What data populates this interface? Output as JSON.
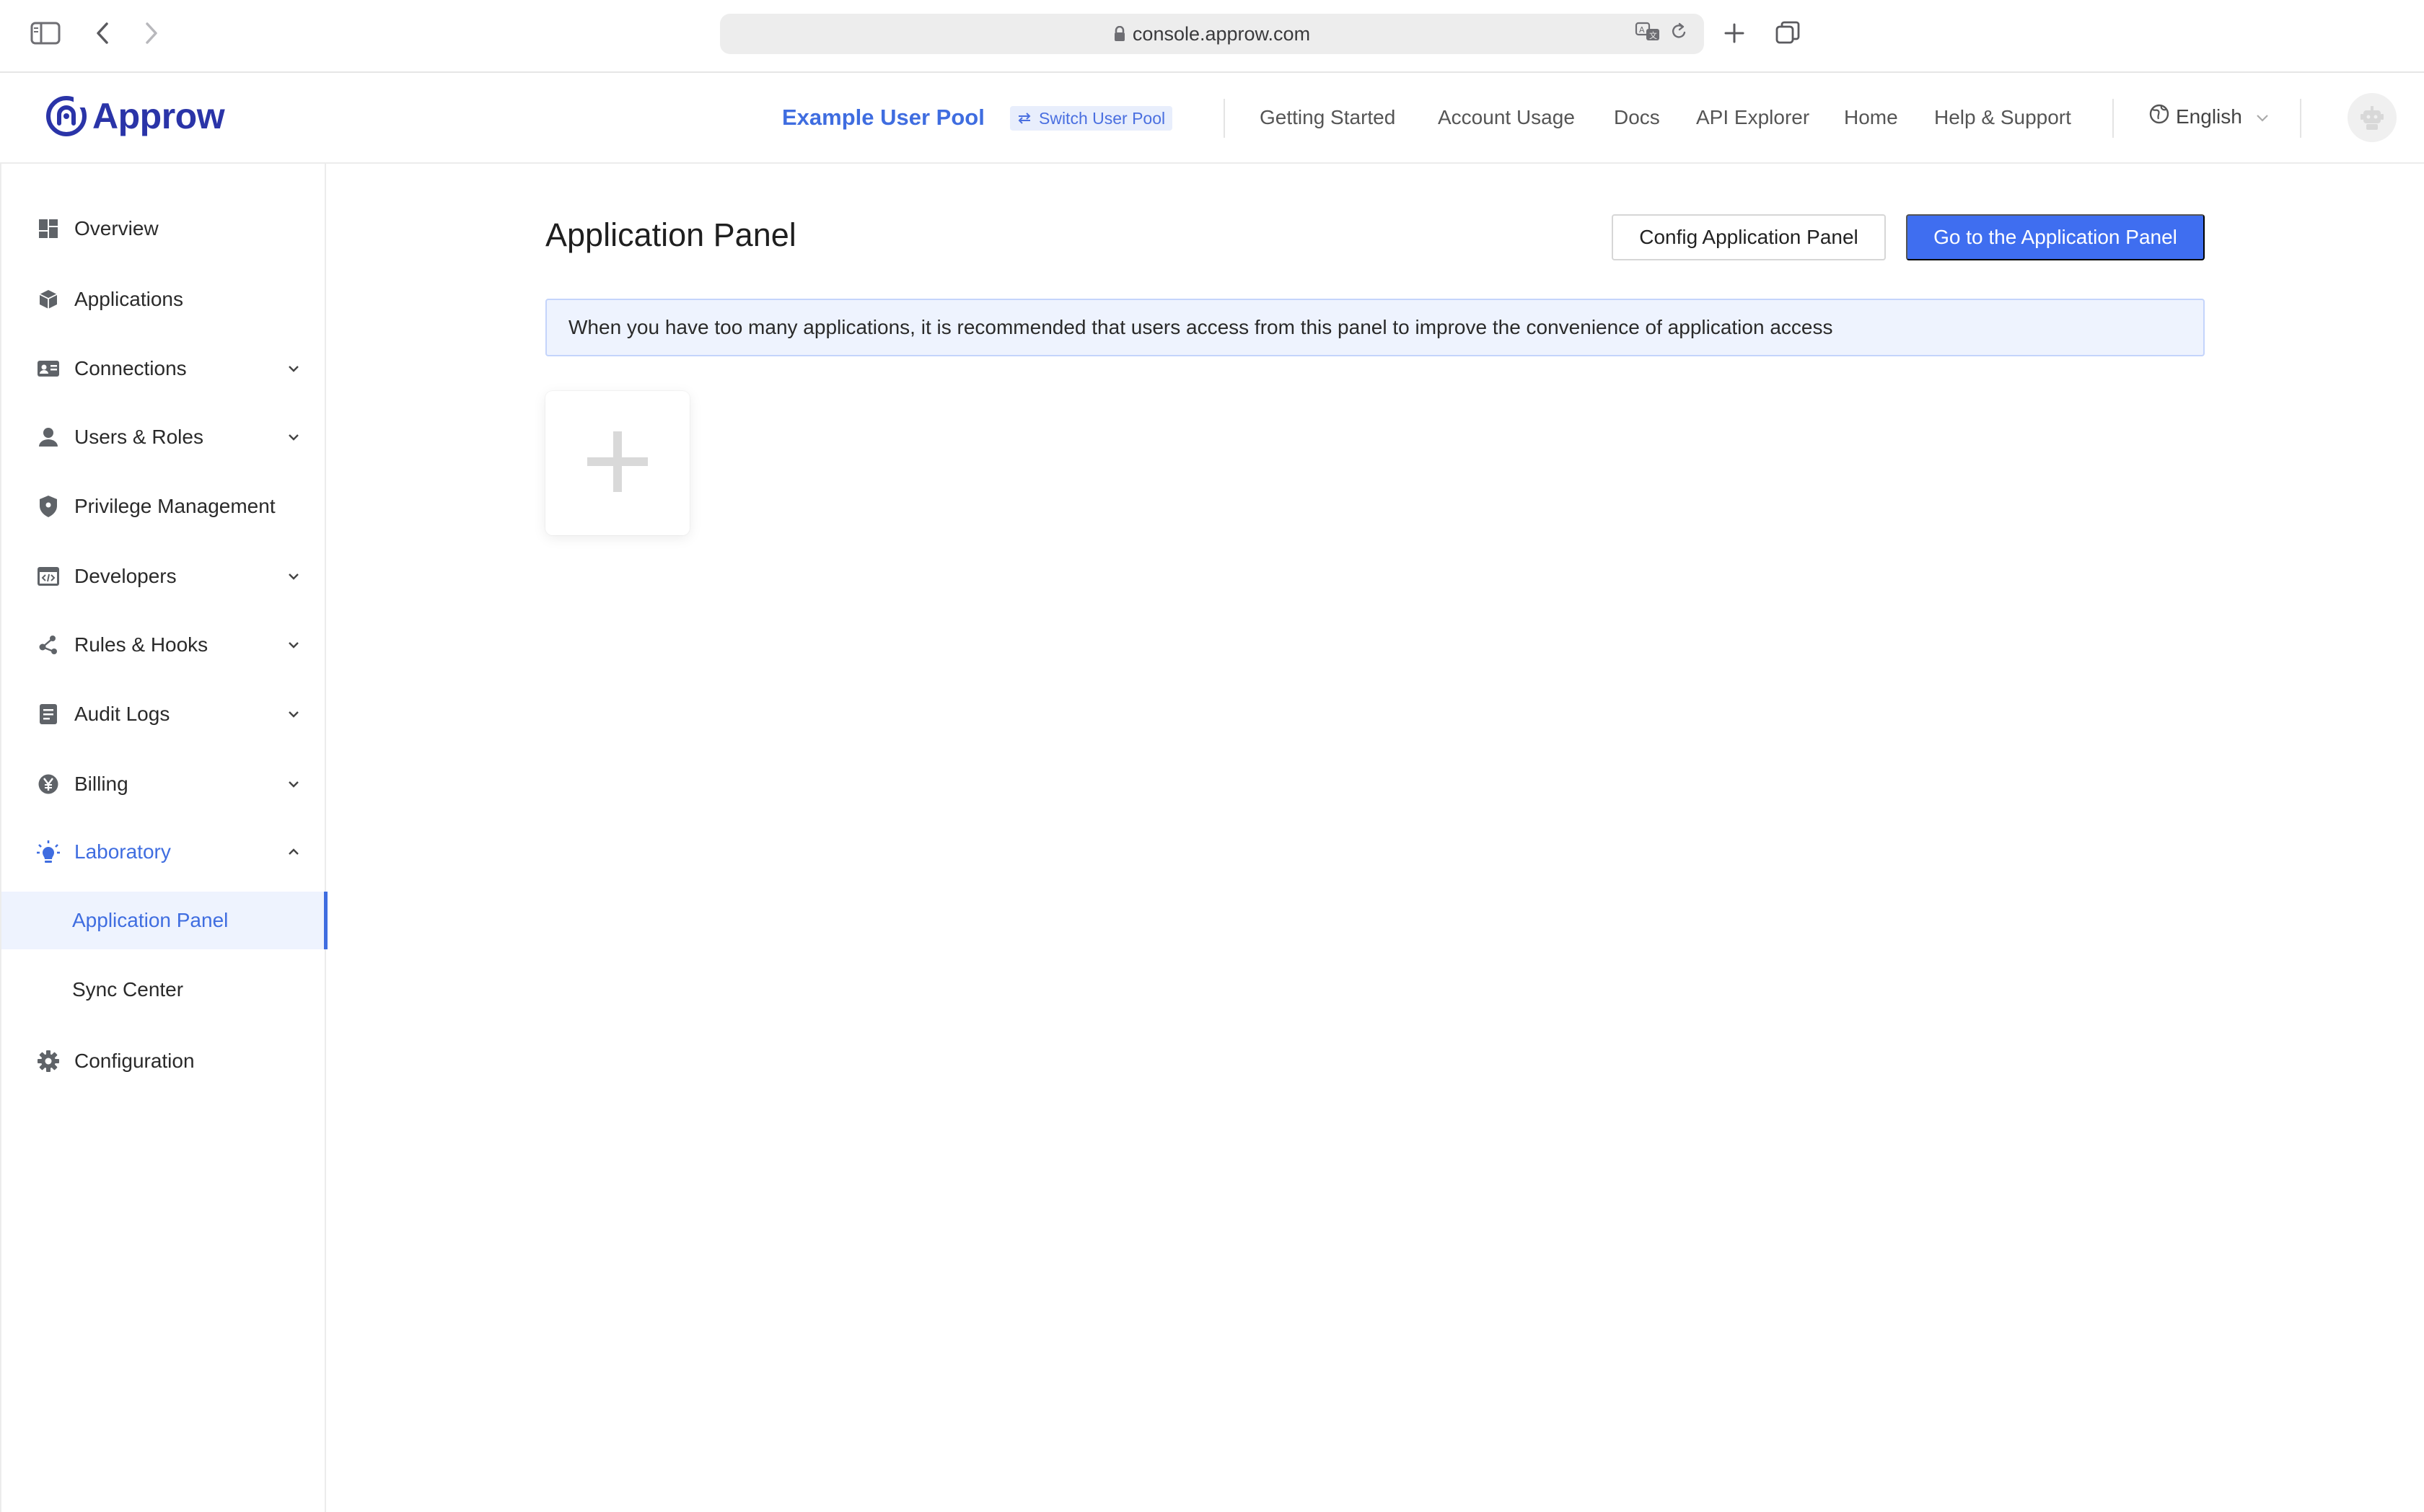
{
  "browser": {
    "url": "console.approw.com",
    "icons": [
      "sidebar-toggle-icon",
      "back-icon",
      "forward-icon",
      "lock-icon",
      "translate-icon",
      "reload-icon",
      "new-tab-icon",
      "tabs-overview-icon"
    ]
  },
  "header": {
    "logo_text": "Approw",
    "pool_name": "Example User Pool",
    "switch_pool_label": "Switch User Pool",
    "nav": [
      "Getting Started",
      "Account Usage",
      "Docs",
      "API Explorer",
      "Home",
      "Help & Support"
    ],
    "language": "English"
  },
  "sidebar": {
    "items": [
      {
        "label": "Overview",
        "icon": "dashboard-icon",
        "expandable": false
      },
      {
        "label": "Applications",
        "icon": "cube-icon",
        "expandable": false
      },
      {
        "label": "Connections",
        "icon": "id-card-icon",
        "expandable": true
      },
      {
        "label": "Users & Roles",
        "icon": "user-icon",
        "expandable": true
      },
      {
        "label": "Privilege Management",
        "icon": "shield-icon",
        "expandable": false
      },
      {
        "label": "Developers",
        "icon": "code-window-icon",
        "expandable": true
      },
      {
        "label": "Rules & Hooks",
        "icon": "nodes-icon",
        "expandable": true
      },
      {
        "label": "Audit Logs",
        "icon": "document-icon",
        "expandable": true
      },
      {
        "label": "Billing",
        "icon": "yen-icon",
        "expandable": true
      },
      {
        "label": "Laboratory",
        "icon": "bulb-icon",
        "expandable": true,
        "expanded": true,
        "active": true
      },
      {
        "label": "Configuration",
        "icon": "gear-icon",
        "expandable": false
      }
    ],
    "laboratory_children": [
      {
        "label": "Application Panel",
        "selected": true
      },
      {
        "label": "Sync Center",
        "selected": false
      }
    ]
  },
  "main": {
    "title": "Application Panel",
    "config_button": "Config Application Panel",
    "go_button": "Go to the Application Panel",
    "notice": "When you have too many applications, it is recommended that users access from this panel to improve the convenience of application access",
    "add_card_icon": "plus-icon"
  },
  "colors": {
    "accent": "#3f6ef0",
    "brand": "#2a34a8",
    "notice_bg": "#eef3fe",
    "notice_border": "#c4d4fb"
  }
}
